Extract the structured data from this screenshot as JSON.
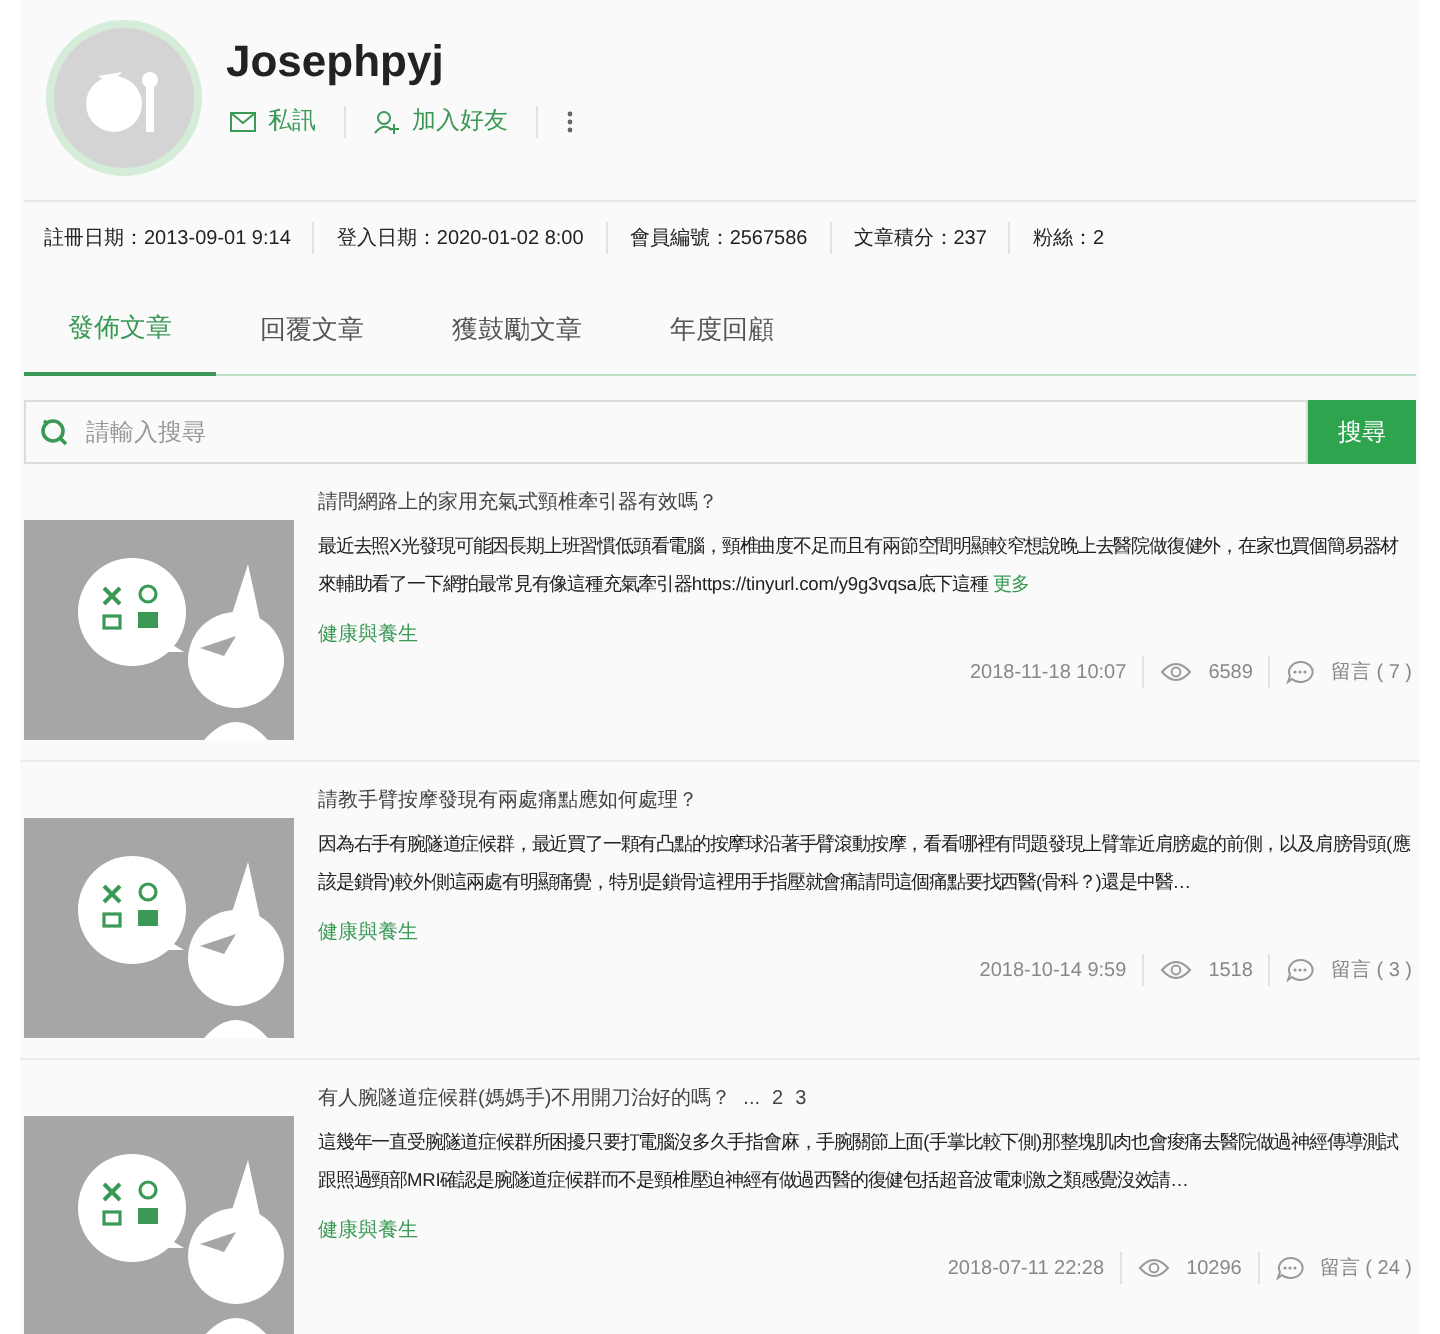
{
  "profile": {
    "name": "Josephpyj",
    "actions": [
      {
        "kind": "message",
        "label": "私訊"
      },
      {
        "kind": "add-friend",
        "label": "加入好友"
      },
      {
        "kind": "more"
      }
    ],
    "stats": [
      "註冊日期：2013-09-01 9:14",
      "登入日期：2020-01-02 8:00",
      "會員編號：2567586",
      "文章積分：237",
      "粉絲：2"
    ]
  },
  "tabs": [
    {
      "label": "發佈文章",
      "selected": true
    },
    {
      "label": "回覆文章",
      "selected": false
    },
    {
      "label": "獲鼓勵文章",
      "selected": false
    },
    {
      "label": "年度回顧",
      "selected": false
    }
  ],
  "search": {
    "placeholder": "請輸入搜尋",
    "button": "搜尋"
  },
  "posts": [
    {
      "title": "請問網路上的家用充氣式頸椎牽引器有效嗎？",
      "excerpt": "最近去照X光發現可能因長期上班習慣低頭看電腦，頸椎曲度不足而且有兩節空間明顯較窄想說晚上去醫院做復健外，在家也買個簡易器材來輔助看了一下網拍最常見有像這種充氣牽引器https://tinyurl.com/y9g3vqsa底下這種",
      "more": "更多",
      "category": "健康與養生",
      "date": "2018-11-18 10:07",
      "views": "6589",
      "comments": "留言 ( 7 )"
    },
    {
      "title": "請教手臂按摩發現有兩處痛點應如何處理？",
      "excerpt": "因為右手有腕隧道症候群，最近買了一顆有凸點的按摩球沿著手臂滾動按摩，看看哪裡有問題發現上臂靠近肩膀處的前側，以及肩膀骨頭(應該是鎖骨)較外側這兩處有明顯痛覺，特別是鎖骨這裡用手指壓就會痛請問這個痛點要找西醫(骨科？)還是中醫…",
      "category": "健康與養生",
      "date": "2018-10-14 9:59",
      "views": "1518",
      "comments": "留言 ( 3 )"
    },
    {
      "title": "有人腕隧道症候群(媽媽手)不用開刀治好的嗎？",
      "pages": [
        "...",
        "2",
        "3"
      ],
      "excerpt": "這幾年一直受腕隧道症候群所困擾只要打電腦沒多久手指會麻，手腕關節上面(手掌比較下側)那整塊肌肉也會痠痛去醫院做過神經傳導測試跟照過頸部MRI確認是腕隧道症候群而不是頸椎壓迫神經有做過西醫的復健包括超音波電刺激之類感覺沒效請…",
      "category": "健康與養生",
      "date": "2018-07-11 22:28",
      "views": "10296",
      "comments": "留言 ( 24 )"
    }
  ]
}
